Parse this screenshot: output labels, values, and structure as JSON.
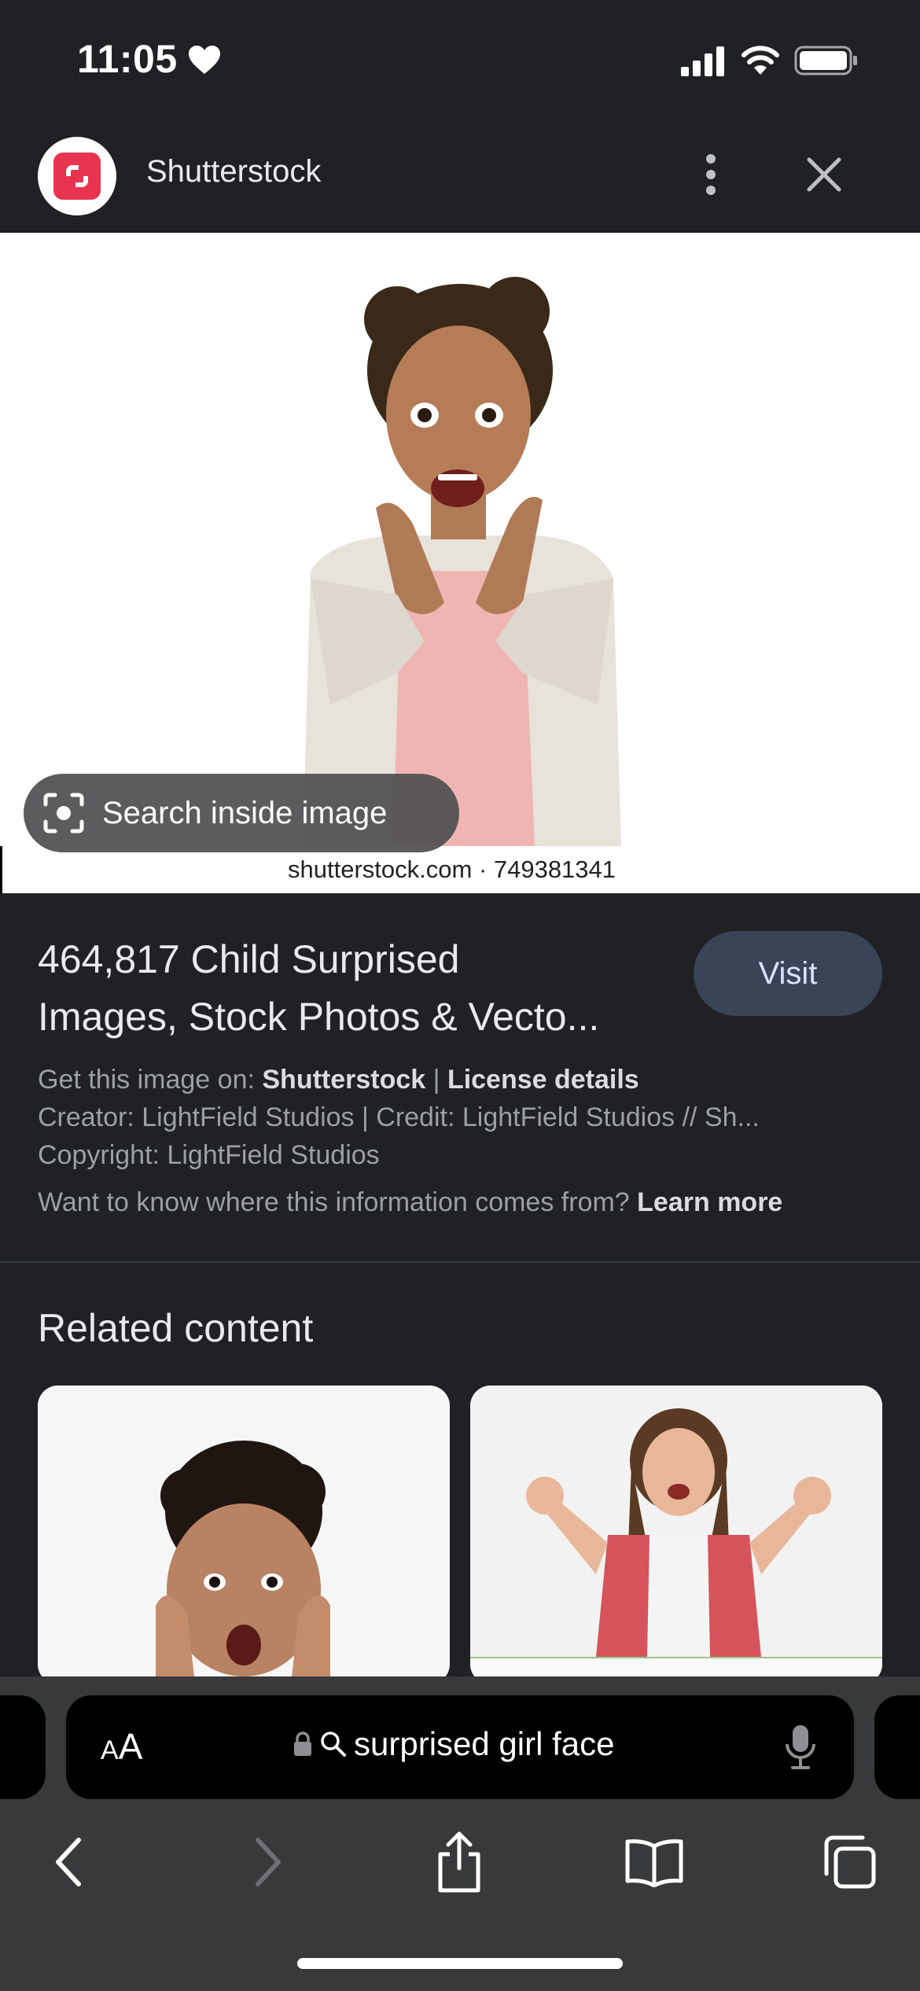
{
  "status_bar": {
    "time": "11:05",
    "icons": [
      "heart-icon",
      "cellular-signal-icon",
      "wifi-icon",
      "battery-icon"
    ]
  },
  "header": {
    "site_name": "Shutterstock",
    "logo_icon": "shutterstock-logo-icon",
    "menu_icon": "more-vertical-icon",
    "close_icon": "close-icon",
    "logo_color": "#e8344e"
  },
  "image_viewer": {
    "search_inside_label": "Search inside image",
    "search_inside_icon": "lens-icon",
    "watermark": "shutterstock.com · 749381341"
  },
  "result": {
    "title_line1": "464,817 Child Surprised",
    "title_line2": "Images, Stock Photos & Vecto...",
    "visit_label": "Visit",
    "get_image_prefix": "Get this image on: ",
    "source": "Shutterstock",
    "separator": " | ",
    "license_details": "License details",
    "creator_line": "Creator: LightField Studios | Credit: LightField Studios // Sh...",
    "copyright_line": "Copyright: LightField Studios",
    "info_question": "Want to know where this information comes from? ",
    "learn_more": "Learn more"
  },
  "related": {
    "heading": "Related content"
  },
  "browser": {
    "aa_label_big": "A",
    "aa_label_small": "A",
    "url_text": "surprised girl face",
    "url_icons": [
      "lock-icon",
      "search-icon",
      "microphone-icon"
    ],
    "toolbar_icons": [
      "back-icon",
      "forward-icon",
      "share-icon",
      "bookmarks-icon",
      "tabs-icon"
    ]
  },
  "colors": {
    "background": "#202124",
    "visit_button": "#394457",
    "bottom_bar": "#38393b"
  }
}
